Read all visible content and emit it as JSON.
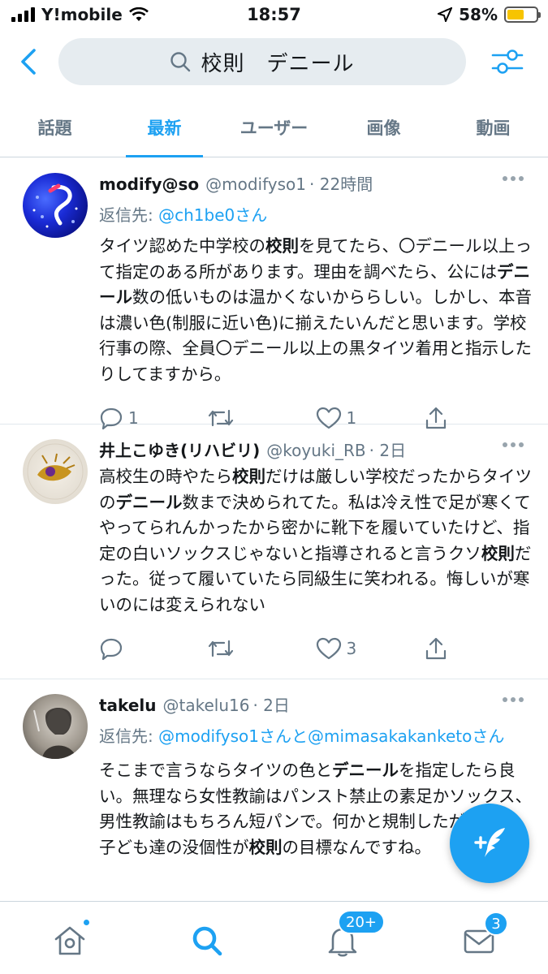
{
  "status_bar": {
    "carrier": "Y!mobile",
    "time": "18:57",
    "battery": "58%",
    "battery_level": 0.58
  },
  "search": {
    "query": "校則　デニール"
  },
  "tabs": [
    {
      "label": "話題",
      "active": false
    },
    {
      "label": "最新",
      "active": true
    },
    {
      "label": "ユーザー",
      "active": false
    },
    {
      "label": "画像",
      "active": false
    },
    {
      "label": "動画",
      "active": false
    }
  ],
  "tweets": [
    {
      "name": "modify@so",
      "handle": "@modifyso1",
      "time": "· 22時間",
      "reply_prefix": "返信先: ",
      "reply_to": "@ch1be0さん",
      "body_html": "タイツ認めた中学校の<b>校則</b>を見てたら、〇デニール以上って指定のある所があります。理由を調べたら、公には<b>デニール</b>数の低いものは温かくないかららしい。しかし、本音は濃い色(制服に近い色)に揃えたいんだと思います。学校行事の際、全員〇デニール以上の黒タイツ着用と指示したりしてますから。",
      "replies": "1",
      "retweets": "",
      "likes": "1"
    },
    {
      "name": "井上こゆき(リハビリ)",
      "handle": "@koyuki_RB",
      "time": "· 2日",
      "reply_prefix": "",
      "reply_to": "",
      "body_html": "高校生の時やたら<b>校則</b>だけは厳しい学校だったからタイツの<b>デニール</b>数まで決められてた。私は冷え性で足が寒くてやってられんかったから密かに靴下を履いていたけど、指定の白いソックスじゃないと指導されると言うクソ<b>校則</b>だった。従って履いていたら同級生に笑われる。悔しいが寒いのには変えられない",
      "replies": "",
      "retweets": "",
      "likes": "3"
    },
    {
      "name": "takelu",
      "handle": "@takelu16",
      "time": "· 2日",
      "reply_prefix": "返信先: ",
      "reply_to": "@modifyso1さんと@mimasakakanketoさん",
      "body_html": "そこまで言うならタイツの色と<b>デニール</b>を指定したら良い。無理なら女性教諭はパンスト禁止の素足かソックス、男性教諭はもちろん短パンで。何かと規制したがるのは子ども達の没個性が<b>校則</b>の目標なんですね。",
      "replies": "",
      "retweets": "",
      "likes": ""
    }
  ],
  "bottom_nav": {
    "notifications_badge": "20+",
    "messages_badge": "3"
  },
  "colors": {
    "accent": "#1da1f2",
    "secondary_text": "#657786",
    "search_bg": "#e6ecf0",
    "battery": "#f7c400"
  },
  "icons": [
    "back-icon",
    "search-icon",
    "filter-icon",
    "more-icon",
    "reply-icon",
    "retweet-icon",
    "like-icon",
    "share-icon",
    "compose-icon",
    "home-icon",
    "notifications-icon",
    "messages-icon"
  ]
}
